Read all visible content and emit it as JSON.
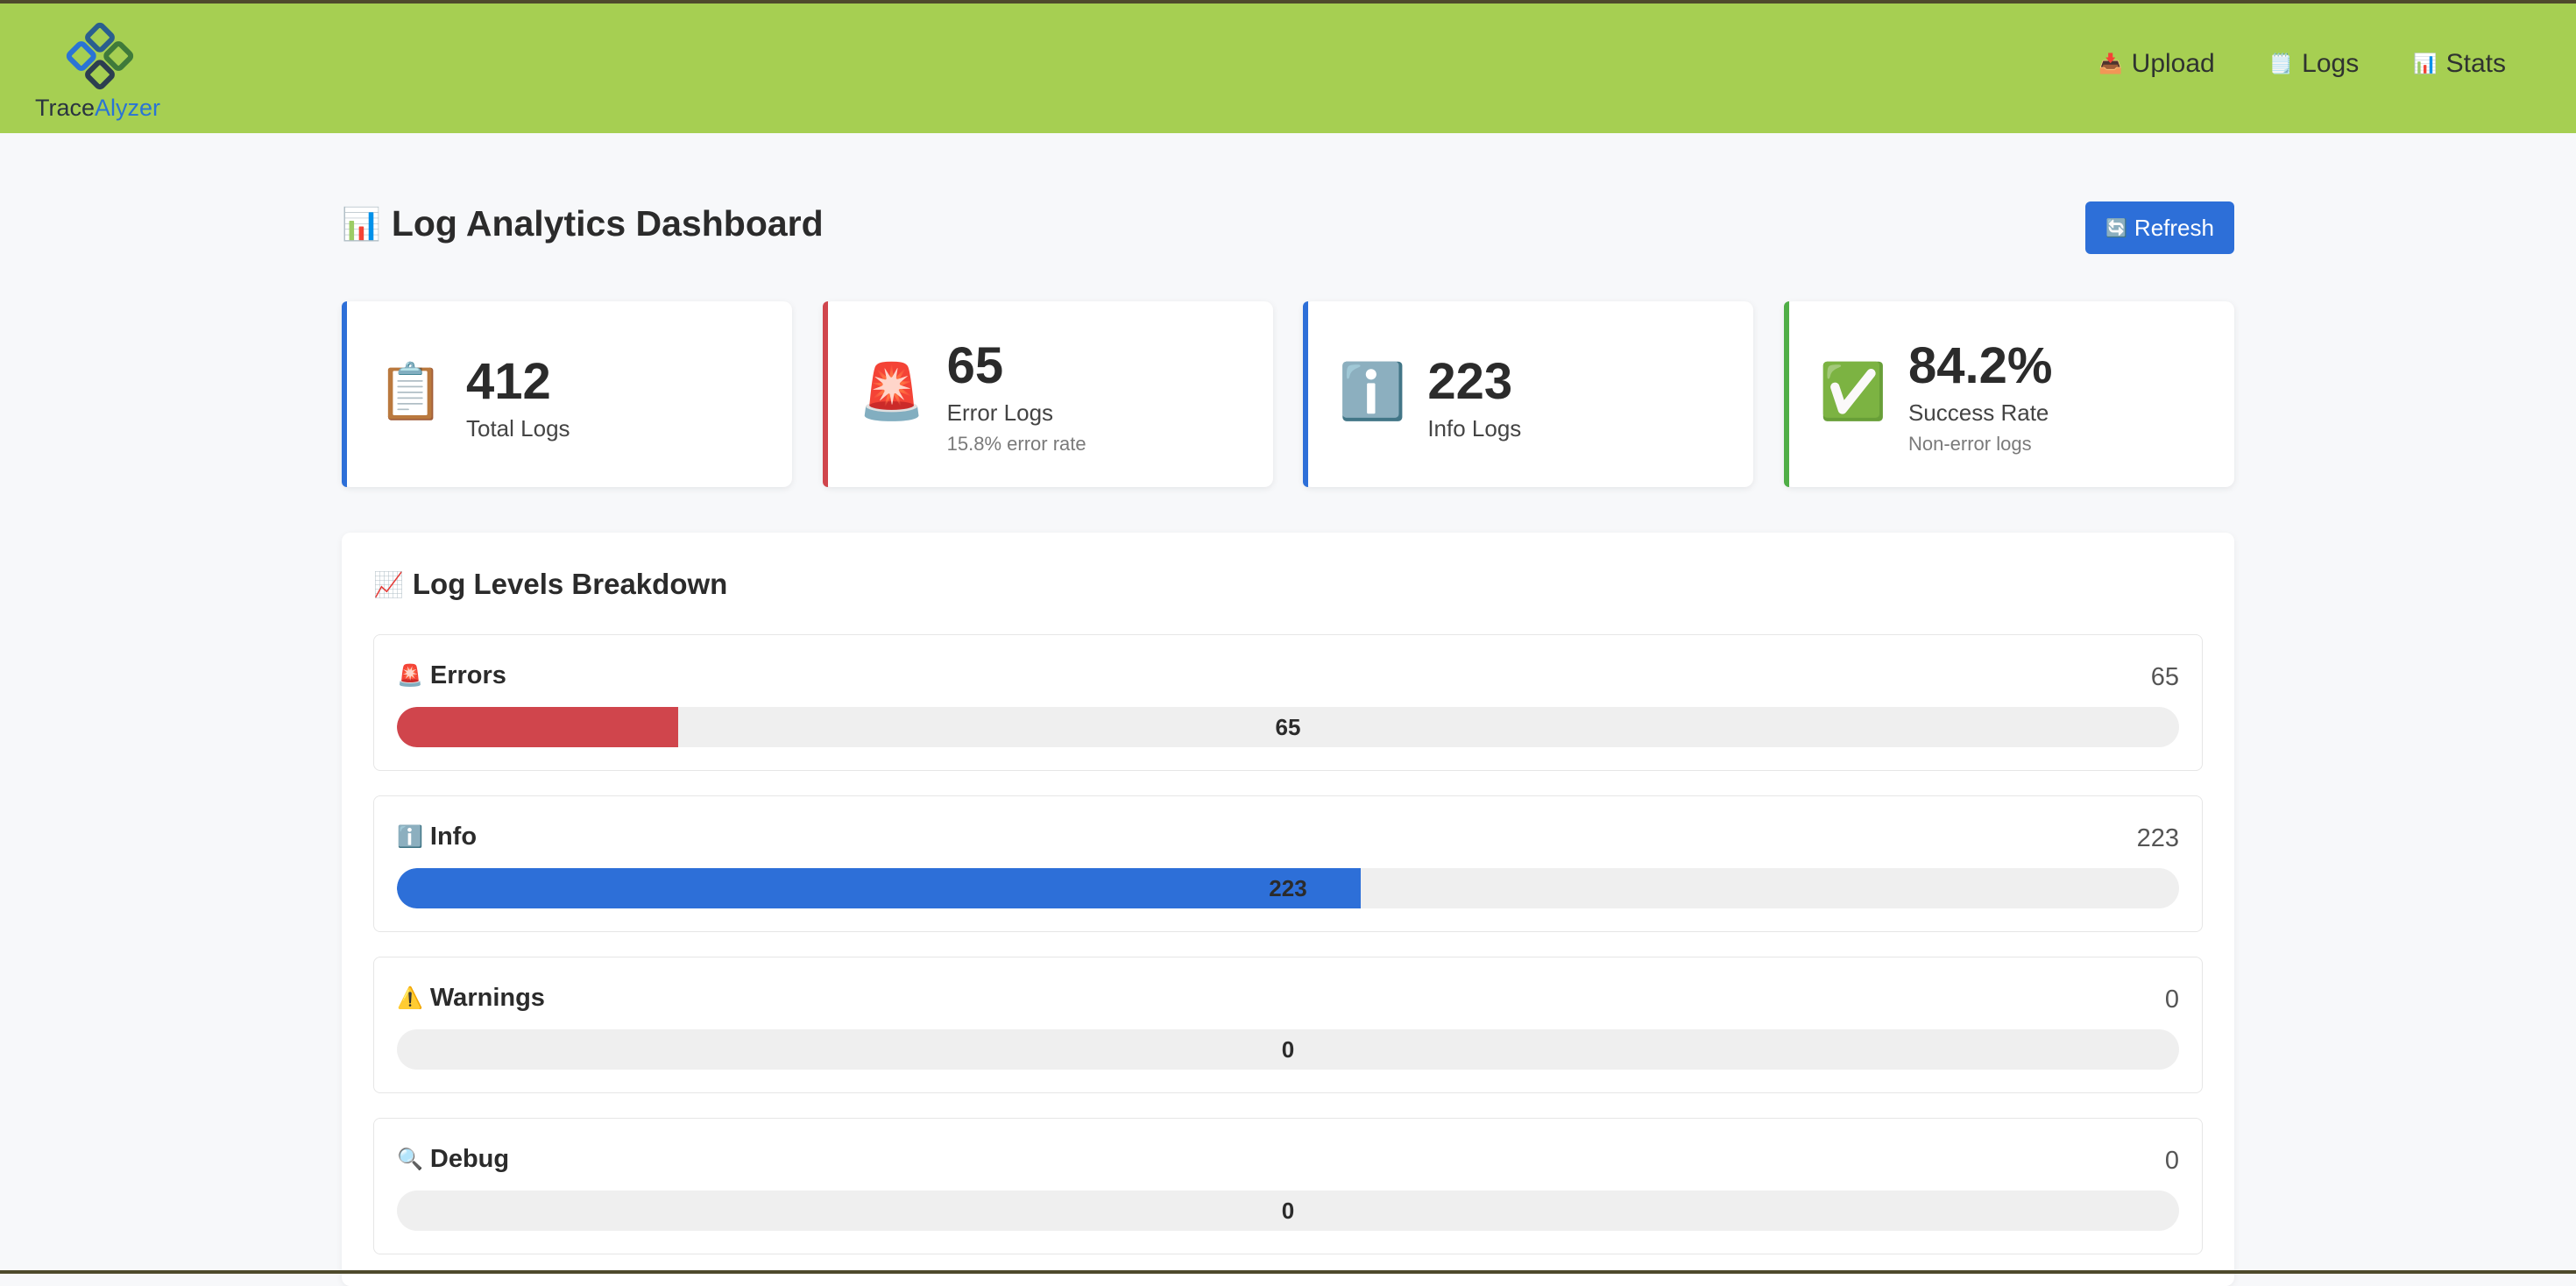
{
  "brand": {
    "name_part1": "Trace",
    "name_part2": "Alyzer",
    "colors": {
      "navbar": "#a6cf52",
      "accent_blue": "#2a74d5"
    }
  },
  "nav": [
    {
      "icon": "inbox-tray-icon",
      "glyph": "📥",
      "label": "Upload"
    },
    {
      "icon": "notepad-icon",
      "glyph": "🗒️",
      "label": "Logs"
    },
    {
      "icon": "bar-chart-icon",
      "glyph": "📊",
      "label": "Stats"
    }
  ],
  "page": {
    "title_glyph": "📊",
    "title": "Log Analytics Dashboard",
    "refresh_glyph": "🔄",
    "refresh_label": "Refresh"
  },
  "stats": [
    {
      "icon": "clipboard-icon",
      "glyph": "📋",
      "value": "412",
      "label": "Total Logs",
      "sub": "",
      "accent": "#2d6fd8"
    },
    {
      "icon": "siren-icon",
      "glyph": "🚨",
      "value": "65",
      "label": "Error Logs",
      "sub": "15.8% error rate",
      "accent": "#d0454c"
    },
    {
      "icon": "info-icon",
      "glyph": "ℹ️",
      "value": "223",
      "label": "Info Logs",
      "sub": "",
      "accent": "#2d6fd8"
    },
    {
      "icon": "check-mark-icon",
      "glyph": "✅",
      "value": "84.2%",
      "label": "Success Rate",
      "sub": "Non-error logs",
      "accent": "#4fae46"
    }
  ],
  "breakdown": {
    "title_glyph": "📈",
    "title": "Log Levels Breakdown",
    "levels": [
      {
        "icon": "siren-icon",
        "glyph": "🚨",
        "name": "Errors",
        "count": "65",
        "bar_label": "65",
        "fraction": 0.158,
        "color": "#d0454c"
      },
      {
        "icon": "info-icon",
        "glyph": "ℹ️",
        "name": "Info",
        "count": "223",
        "bar_label": "223",
        "fraction": 0.541,
        "color": "#2d6fd8"
      },
      {
        "icon": "warning-icon",
        "glyph": "⚠️",
        "name": "Warnings",
        "count": "0",
        "bar_label": "0",
        "fraction": 0,
        "color": "#e8a93a"
      },
      {
        "icon": "magnifier-icon",
        "glyph": "🔍",
        "name": "Debug",
        "count": "0",
        "bar_label": "0",
        "fraction": 0,
        "color": "#7a7a7a"
      }
    ]
  }
}
